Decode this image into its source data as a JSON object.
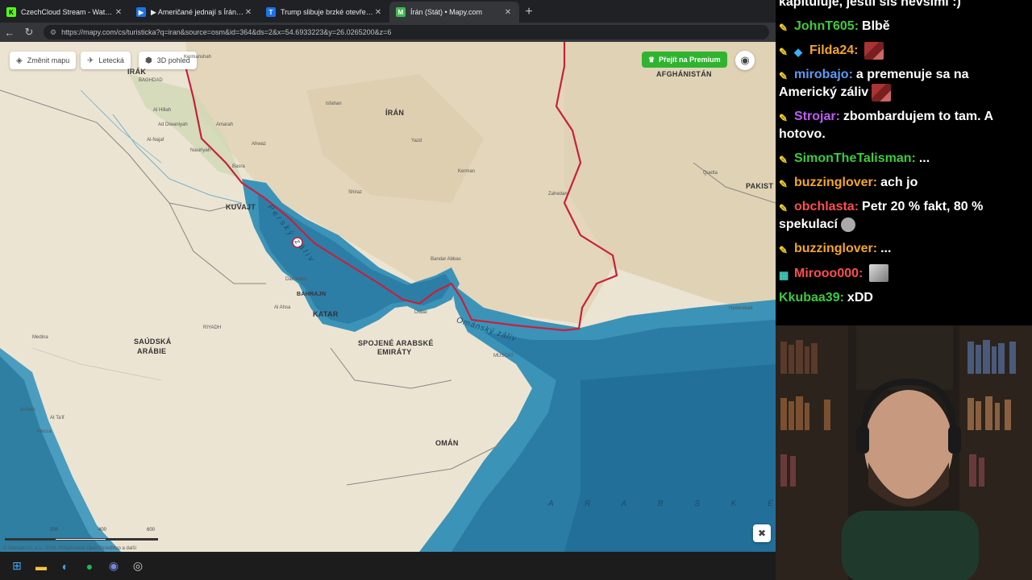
{
  "browser": {
    "tabs": [
      {
        "title": "CzechCloud Stream - Watch Live o",
        "favicon": "K",
        "favicon_color": "#53fc18",
        "close": "✕"
      },
      {
        "title": "▶ Američané jednají s Íránci v Páki",
        "favicon": "▶",
        "favicon_color": "#1a73e8",
        "close": "✕"
      },
      {
        "title": "Trump slibuje brzké otevření Horm",
        "favicon": "T",
        "favicon_color": "#1a73e8",
        "close": "✕"
      },
      {
        "title": "Írán (Stát) • Mapy.com",
        "favicon": "M",
        "favicon_color": "#3fb950",
        "close": "✕",
        "active": true
      }
    ],
    "new_tab": "+",
    "url": "https://mapy.com/cs/turisticka?q=iran&source=osm&id=364&ds=2&x=54.6933223&y=26.0265200&z=6"
  },
  "map": {
    "buttons": {
      "change_map": "Změnit mapu",
      "aerial": "Letecká",
      "view3d": "3D pohled",
      "premium": "Přejít na Premium"
    },
    "countries": {
      "irak": "IRÁK",
      "iran": "ÍRÁN",
      "afghanistan": "AFGHÁNISTÁN",
      "pakistan": "PAKIST",
      "kuvajt": "KUVAJT",
      "bahrajn": "BAHRAJN",
      "katar": "KATAR",
      "saudi_1": "SAÚDSKÁ",
      "saudi_2": "ARÁBIE",
      "sae_1": "SPOJENÉ ARABSKÉ",
      "sae_2": "EMIRÁTY",
      "oman": "OMÁN"
    },
    "seas": {
      "persian_gulf": "Perský záliv",
      "oman_gulf": "Ománský záliv",
      "arabian": "A R A B S K É"
    },
    "cities": {
      "kermanshah": "Kermanshah",
      "baghdad": "BAGHDAD",
      "al_hillah": "Al Hillah",
      "al_diwaniyah": "Ad Diwaniyah",
      "al_najaf": "Al-Najaf",
      "nasiriyah": "Nasiriyah",
      "amarah": "Amarah",
      "ahwaz": "Ahwaz",
      "isfahan": "Isfahan",
      "yazd": "Yazd",
      "shiraz": "Shiraz",
      "kerman": "Kerman",
      "bandar_abbas": "Bandar Abbas",
      "zahedan": "Zahedan",
      "quetta": "Quetta",
      "dammam": "Dammam",
      "al_ahsa": "Al Ahsa",
      "riyadh": "RIYADH",
      "medina": "Medina",
      "jeddah": "Jeddah",
      "at_taif": "At Ta'if",
      "mecca": "Mecca",
      "dubai": "Dubai",
      "muscat": "MUSCAT",
      "hyderabad": "Hyderabad",
      "basra": "Basra"
    },
    "scale": {
      "t1": "200",
      "t2": "400",
      "t3": "600"
    },
    "copyright": "© Seznam.cz, a.s., 2026, Přispěvatelé OpenStreetMap a další"
  },
  "chat": [
    {
      "user": "",
      "text": "kapituluje, jestli sis nevšimi :)",
      "color": "#ffffff",
      "first": true
    },
    {
      "user": "JohnT605:",
      "text": "Blbě",
      "color": "#3ccc3c"
    },
    {
      "user": "Filda24:",
      "text": "",
      "color": "#f5a623",
      "emote": true,
      "badge2": true
    },
    {
      "user": "mirobajo:",
      "text": "a premenuje sa na Americký záliv",
      "color": "#5c9cf5",
      "emote": true
    },
    {
      "user": "Strojar:",
      "text": "zbombardujem to tam. A hotovo.",
      "color": "#c05cf5"
    },
    {
      "user": "SimonTheTalisman:",
      "text": "...",
      "color": "#3ccc3c"
    },
    {
      "user": "buzzinglover:",
      "text": "ach jo",
      "color": "#f5a623"
    },
    {
      "user": "obchlasta:",
      "text": "Petr 20 % fakt, 80 % spekulací",
      "color": "#ff4d4d"
    },
    {
      "user": "buzzinglover:",
      "text": "...",
      "color": "#f5a623"
    },
    {
      "user": "Mirooo000:",
      "text": "",
      "color": "#ff4d4d",
      "emote": true
    },
    {
      "user": "Kkubaa39:",
      "text": "xDD",
      "color": "#3ccc3c",
      "nobadge": true
    }
  ]
}
